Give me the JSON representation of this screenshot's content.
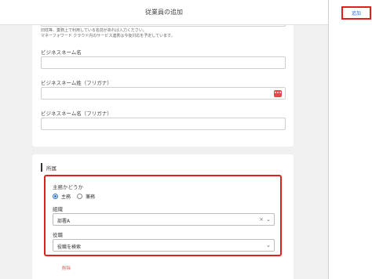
{
  "header": {
    "title": "従業員の追加"
  },
  "side_panel": {
    "add_label": "追加"
  },
  "form": {
    "help_text_line1": "旧姓等、業務上で利用している名前があれば入力ください。",
    "help_text_line2": "マネーフォワード クラウド内のサービス連携は今後対応を予定しています。",
    "business_name": {
      "label": "ビジネスネーム名",
      "value": ""
    },
    "business_name_kana_last": {
      "label": "ビジネスネーム姓（フリガナ）",
      "value": ""
    },
    "business_name_kana_first": {
      "label": "ビジネスネーム名（フリガナ）",
      "value": ""
    }
  },
  "affiliation": {
    "title": "所属",
    "main_or_sub": {
      "label": "主務かどうか",
      "options": [
        "主務",
        "兼務"
      ],
      "selected": "主務"
    },
    "department": {
      "label": "組織",
      "value": "部署A"
    },
    "position": {
      "label": "役職",
      "placeholder": "役職を検索"
    },
    "delete_label": "削除"
  },
  "icons": {
    "password_manager": "password-manager-icon",
    "clear": "clear-icon",
    "dropdown": "chevron-down-icon"
  },
  "colors": {
    "highlight": "#e02020",
    "accent": "#2a6fdb",
    "delete": "#e25555"
  }
}
